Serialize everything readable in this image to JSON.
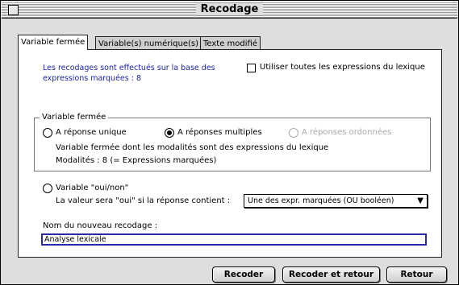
{
  "window": {
    "title": "Recodage"
  },
  "tabs": [
    {
      "label": "Variable fermée"
    },
    {
      "label": "Variable(s) numérique(s)"
    },
    {
      "label": "Texte modifié"
    }
  ],
  "info": {
    "line1": "Les recodages sont effectués sur la base des",
    "line2": "expressions marquées : 8"
  },
  "use_all_checkbox": {
    "label": "Utiliser toutes les expressions du lexique",
    "checked": false
  },
  "closed_variable_group": {
    "legend": "Variable fermée",
    "radio_single": {
      "label": "A réponse unique",
      "selected": false
    },
    "radio_multiple": {
      "label": "A réponses multiples",
      "selected": true
    },
    "radio_ordered": {
      "label": "A réponses ordonnées",
      "enabled": false
    },
    "desc1": "Variable fermée dont les modalités sont  des expressions du lexique",
    "desc2": "Modalités : 8 (= Expressions marquées)"
  },
  "yes_no": {
    "radio_label": "Variable \"oui/non\"",
    "selected": false,
    "desc": "La valeur sera \"oui\" si la réponse contient :",
    "select_value": "Une des expr. marquées (OU booléen)"
  },
  "new_recode": {
    "label": "Nom du nouveau recodage :",
    "value": "Analyse lexicale"
  },
  "buttons": {
    "recode": "Recoder",
    "recode_return": "Recoder et retour",
    "return": "Retour"
  }
}
